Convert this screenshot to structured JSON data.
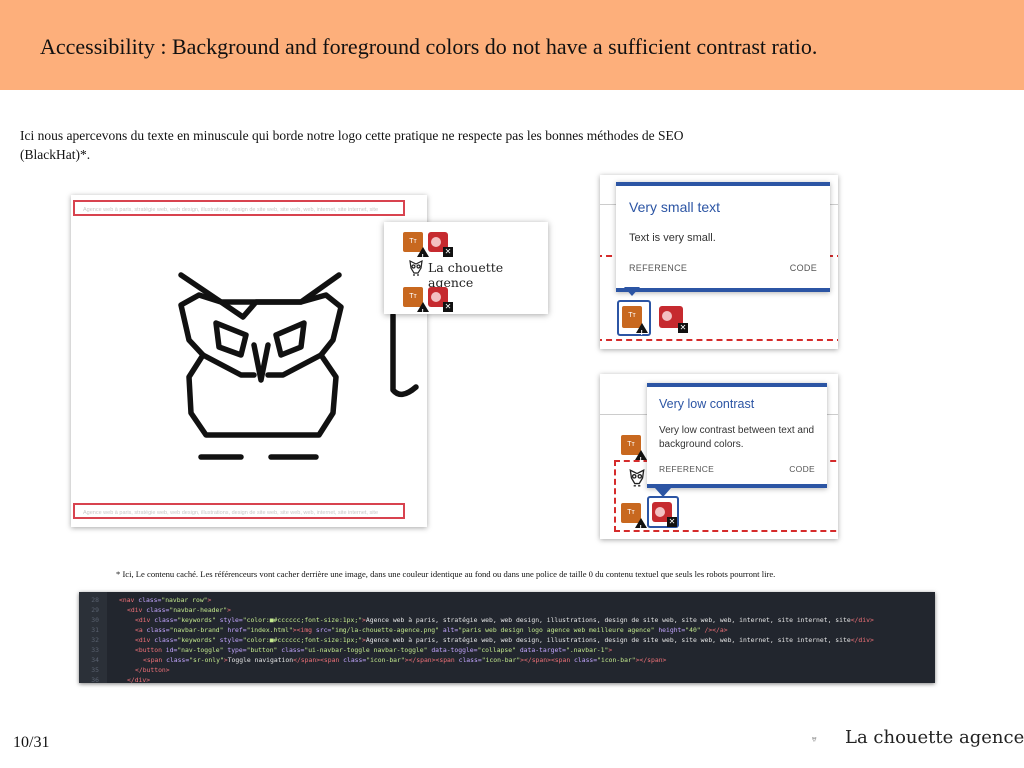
{
  "slide": {
    "title": "Accessibility : Background and foreground colors do not have a sufficient contrast ratio.",
    "intro": "Ici nous apercevons du texte en minuscule qui borde notre logo cette pratique ne respecte pas les bonnes méthodes de SEO (BlackHat)*.",
    "footnote": "* Ici, Le contenu caché. Les référenceurs vont cacher derrière une image, dans une couleur identique au fond ou dans une police de taille 0 du contenu textuel que seuls les robots pourront lire.",
    "page_number": "10/31"
  },
  "screenshot1": {
    "keywords_text": "Agence web à paris, stratégie web, web design, illustrations, design de site web, site web, web, internet, site internet, site",
    "popup_brand": "La chouette agence",
    "icon_tt_label": "Tт"
  },
  "tooltip_small": {
    "title": "Very small text",
    "body": "Text is very small.",
    "reference": "REFERENCE",
    "code": "CODE"
  },
  "tooltip_contrast": {
    "title": "Very low contrast",
    "body": "Very low contrast between text and background colors.",
    "reference": "REFERENCE",
    "code": "CODE"
  },
  "code_lines": [
    {
      "n": "28",
      "p": [
        [
          "t",
          "<nav "
        ],
        [
          "a",
          "class="
        ],
        [
          "s",
          "\"navbar row\""
        ],
        [
          "t",
          ">"
        ]
      ]
    },
    {
      "n": "29",
      "p": [
        [
          "t",
          "<div "
        ],
        [
          "a",
          "class="
        ],
        [
          "s",
          "\"navbar-header\""
        ],
        [
          "t",
          ">"
        ]
      ]
    },
    {
      "n": "30",
      "p": [
        [
          "t",
          "<div "
        ],
        [
          "a",
          "class="
        ],
        [
          "s",
          "\"keywords\" "
        ],
        [
          "a",
          "style="
        ],
        [
          "s",
          "\"color:■#cccccc;font-size:1px;\""
        ],
        [
          "t",
          ">"
        ],
        [
          "tx",
          "Agence web à paris, stratégie web, web design, illustrations, design de site web, site web, web, internet, site internet, site"
        ],
        [
          "t",
          "</div>"
        ]
      ]
    },
    {
      "n": "31",
      "p": [
        [
          "t",
          "<a "
        ],
        [
          "a",
          "class="
        ],
        [
          "s",
          "\"navbar-brand\" "
        ],
        [
          "a",
          "href="
        ],
        [
          "s",
          "\"index.html\""
        ],
        [
          "t",
          "><img "
        ],
        [
          "a",
          "src="
        ],
        [
          "s",
          "\"img/la-chouette-agence.png\" "
        ],
        [
          "a",
          "alt="
        ],
        [
          "s",
          "\"paris web design logo agence web meilleure agence\" "
        ],
        [
          "a",
          "height="
        ],
        [
          "s",
          "\"40\""
        ],
        [
          "t",
          " /></a>"
        ]
      ]
    },
    {
      "n": "32",
      "p": [
        [
          "t",
          "<div "
        ],
        [
          "a",
          "class="
        ],
        [
          "s",
          "\"keywords\" "
        ],
        [
          "a",
          "style="
        ],
        [
          "s",
          "\"color:■#cccccc;font-size:1px;\""
        ],
        [
          "t",
          ">"
        ],
        [
          "tx",
          "Agence web à paris, stratégie web, web design, illustrations, design de site web, site web, web, internet, site internet, site"
        ],
        [
          "t",
          "</div>"
        ]
      ]
    },
    {
      "n": "33",
      "p": [
        [
          "t",
          "<button "
        ],
        [
          "a",
          "id="
        ],
        [
          "s",
          "\"nav-toggle\" "
        ],
        [
          "a",
          "type="
        ],
        [
          "s",
          "\"button\" "
        ],
        [
          "a",
          "class="
        ],
        [
          "s",
          "\"ui-navbar-toggle navbar-toggle\" "
        ],
        [
          "a",
          "data-toggle="
        ],
        [
          "s",
          "\"collapse\" "
        ],
        [
          "a",
          "data-target="
        ],
        [
          "s",
          "\".navbar-1\""
        ],
        [
          "t",
          ">"
        ]
      ]
    },
    {
      "n": "34",
      "p": [
        [
          "t",
          "<span "
        ],
        [
          "a",
          "class="
        ],
        [
          "s",
          "\"sr-only\""
        ],
        [
          "t",
          ">"
        ],
        [
          "tx",
          "Toggle navigation"
        ],
        [
          "t",
          "</span><span "
        ],
        [
          "a",
          "class="
        ],
        [
          "s",
          "\"icon-bar\""
        ],
        [
          "t",
          "></span><span "
        ],
        [
          "a",
          "class="
        ],
        [
          "s",
          "\"icon-bar\""
        ],
        [
          "t",
          "></span><span "
        ],
        [
          "a",
          "class="
        ],
        [
          "s",
          "\"icon-bar\""
        ],
        [
          "t",
          "></span>"
        ]
      ]
    },
    {
      "n": "35",
      "p": [
        [
          "t",
          "</button>"
        ]
      ]
    },
    {
      "n": "36",
      "p": [
        [
          "t",
          "</div>"
        ]
      ]
    }
  ],
  "footer": {
    "brand": "La chouette agence"
  },
  "colors": {
    "header_band": "#fdaf7b",
    "accent_blue": "#2c55a4",
    "error_red": "#d52b2b"
  }
}
